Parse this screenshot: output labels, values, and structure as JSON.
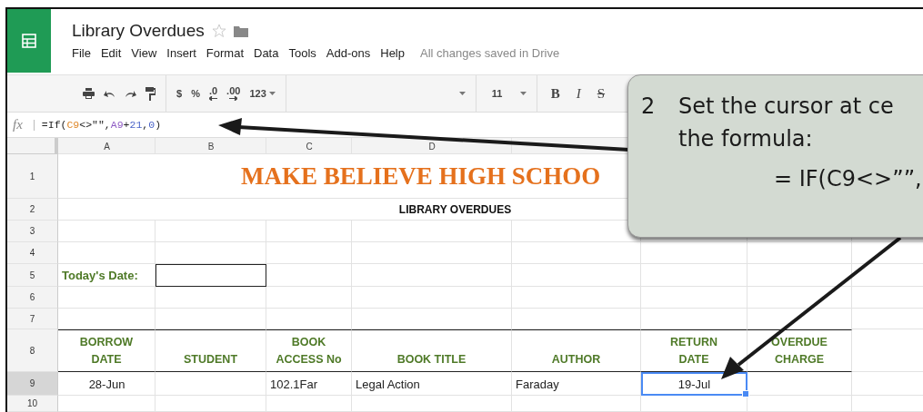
{
  "document": {
    "title": "Library Overdues",
    "starred": false
  },
  "menu": [
    {
      "label": "File"
    },
    {
      "label": "Edit"
    },
    {
      "label": "View"
    },
    {
      "label": "Insert"
    },
    {
      "label": "Format"
    },
    {
      "label": "Data"
    },
    {
      "label": "Tools"
    },
    {
      "label": "Add-ons"
    },
    {
      "label": "Help"
    }
  ],
  "save_status": "All changes saved in Drive",
  "toolbar": {
    "currency": "$",
    "percent": "%",
    "decrease_decimals": ".0",
    "increase_decimals": ".00",
    "number_format": "123",
    "font_size": "11",
    "bold": "B",
    "italic": "I",
    "strikethrough": "S"
  },
  "formula_bar": {
    "label": "fx",
    "formula": "=If(C9<>\"\",A9+21,0)"
  },
  "columns": [
    {
      "label": "A"
    },
    {
      "label": "B"
    },
    {
      "label": "C"
    },
    {
      "label": "D"
    }
  ],
  "rows": [
    {
      "label": "1",
      "selected": false
    },
    {
      "label": "2",
      "selected": false
    },
    {
      "label": "3",
      "selected": false
    },
    {
      "label": "4",
      "selected": false
    },
    {
      "label": "5",
      "selected": false
    },
    {
      "label": "6",
      "selected": false
    },
    {
      "label": "7",
      "selected": false
    },
    {
      "label": "8",
      "selected": false
    },
    {
      "label": "9",
      "selected": true
    },
    {
      "label": "10",
      "selected": false
    }
  ],
  "sheet": {
    "title": "MAKE BELIEVE HIGH SCHOO",
    "subtitle": "LIBRARY OVERDUES",
    "date_label": "Today's Date:",
    "headers": [
      {
        "lines": [
          "BORROW",
          "DATE"
        ]
      },
      {
        "lines": [
          "STUDENT"
        ]
      },
      {
        "lines": [
          "BOOK",
          "ACCESS No"
        ]
      },
      {
        "lines": [
          "BOOK TITLE"
        ]
      },
      {
        "lines": [
          "AUTHOR"
        ]
      },
      {
        "lines": [
          "RETURN",
          "DATE"
        ]
      },
      {
        "lines": [
          "OVERDUE",
          "CHARGE"
        ]
      }
    ],
    "data_row": [
      {
        "text": "28-Jun",
        "selected": false
      },
      {
        "selected": false
      },
      {
        "text": "102.1Far",
        "selected": false
      },
      {
        "text": "Legal Action",
        "selected": false
      },
      {
        "text": "Faraday",
        "selected": false
      },
      {
        "text": "19-Jul",
        "selected": true
      },
      {
        "selected": false
      }
    ]
  },
  "callout": {
    "step": "2",
    "lines": [
      "Set the cursor at ce",
      "the formula:"
    ],
    "formula": "= IF(C9<>””,"
  }
}
